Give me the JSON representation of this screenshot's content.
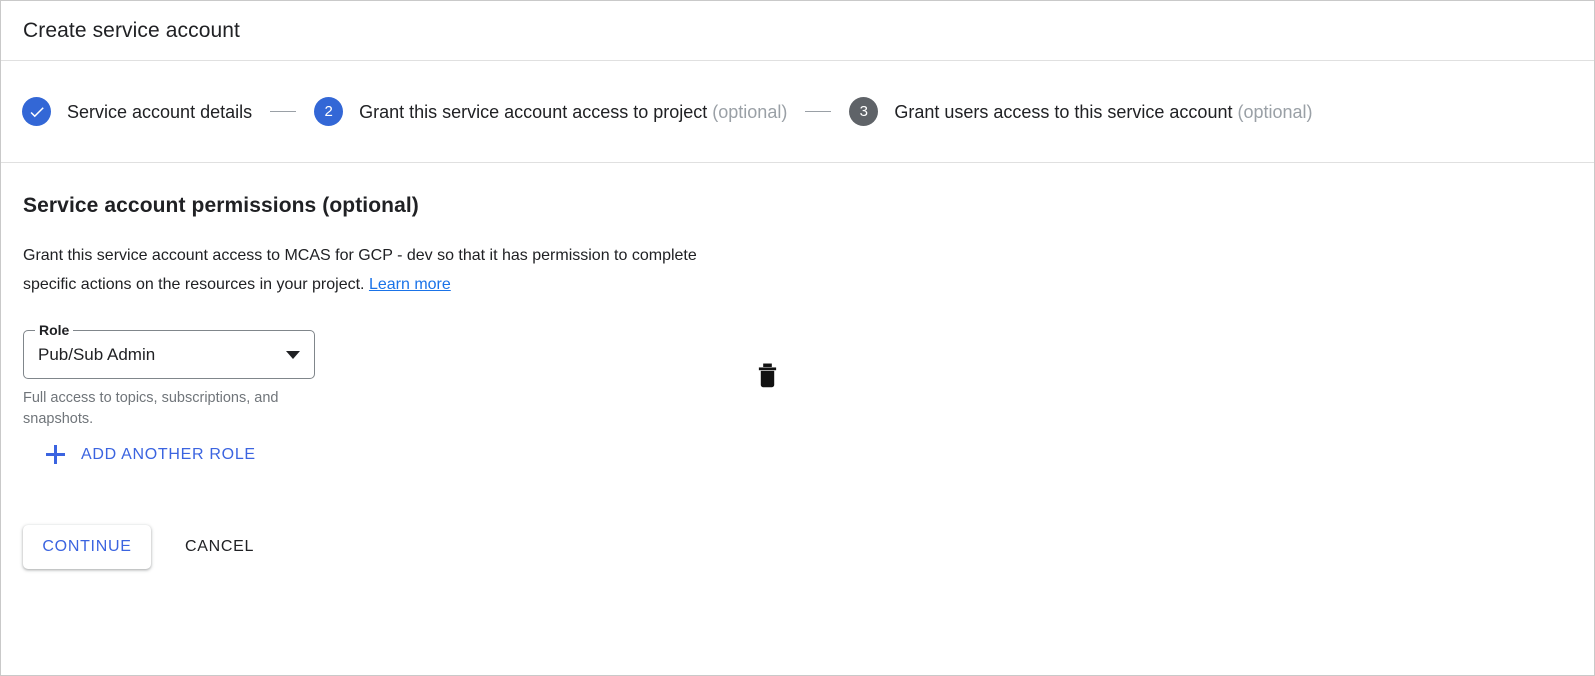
{
  "header": {
    "title": "Create service account"
  },
  "stepper": {
    "steps": [
      {
        "badge": "check",
        "state": "done",
        "label": "Service account details",
        "optional": ""
      },
      {
        "badge": "2",
        "state": "active",
        "label": "Grant this service account access to project",
        "optional": "(optional)"
      },
      {
        "badge": "3",
        "state": "inactive",
        "label": "Grant users access to this service account",
        "optional": "(optional)"
      }
    ]
  },
  "main": {
    "section_title": "Service account permissions (optional)",
    "description_part1": "Grant this service account access to MCAS for GCP - dev so that it has permission to complete specific actions on the resources in your project. ",
    "learn_more_label": "Learn more",
    "role": {
      "label": "Role",
      "value": "Pub/Sub Admin",
      "helper_text": "Full access to topics, subscriptions, and snapshots.",
      "delete_icon": "trash-icon",
      "dropdown_icon": "chevron-down-icon"
    },
    "add_role": {
      "icon": "plus-icon",
      "label": "ADD ANOTHER ROLE"
    }
  },
  "footer": {
    "continue_label": "CONTINUE",
    "cancel_label": "CANCEL"
  },
  "colors": {
    "accent_blue": "#3367d6",
    "link_blue": "#1a73e8",
    "button_blue": "#3b64e0",
    "inactive_gray": "#5f6368",
    "optional_gray": "#9aa0a6",
    "helper_gray": "#70757a",
    "text_primary": "#202124",
    "divider": "#e0e0e0"
  }
}
